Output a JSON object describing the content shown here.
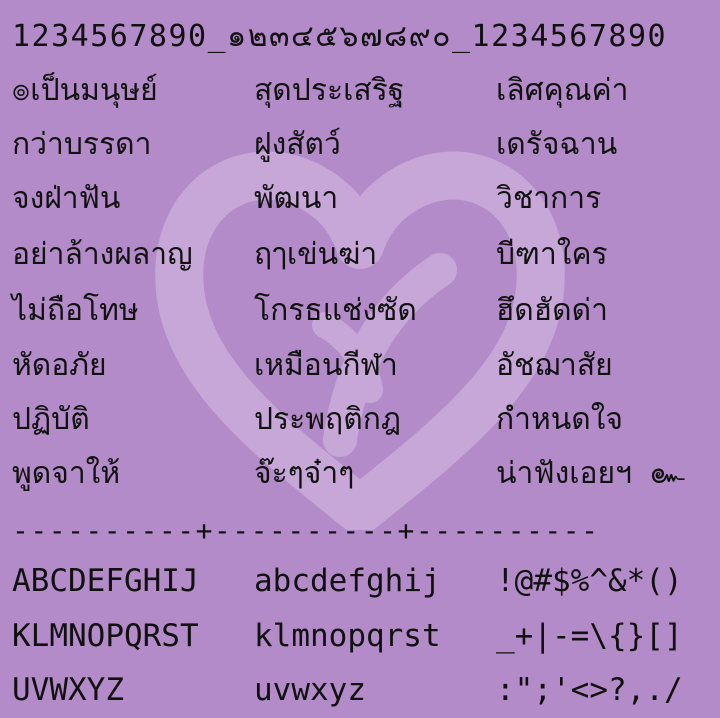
{
  "header_line": "1234567890_๑๒๓๔๕๖๗๘๙๐_1234567890",
  "thai_rows": [
    [
      "๏เป็นมนุษย์",
      "สุดประเสริฐ",
      "เลิศคุณค่า"
    ],
    [
      "กว่าบรรดา",
      "ฝูงสัตว์",
      "เดรัจฉาน"
    ],
    [
      "จงฝ่าฟัน",
      "พัฒนา",
      "วิชาการ"
    ],
    [
      "อย่าล้างผลาญ",
      "ฤๅเข่นฆ่า",
      "บีฑาใคร"
    ],
    [
      "ไม่ถือโทษ",
      "โกรธแช่งซัด",
      "ฮึดฮัดด่า"
    ],
    [
      "หัดอภัย",
      "เหมือนกีฬา",
      "อัชฌาสัย"
    ],
    [
      "ปฏิบัติ",
      "ประพฤติกฎ",
      "กำหนดใจ"
    ],
    [
      "พูดจาให้",
      "จ๊ะๆจ๋าๆ",
      "น่าฟังเอยฯ ๛"
    ]
  ],
  "divider": "----------+----------+----------",
  "latin_rows": [
    [
      "ABCDEFGHIJ",
      "abcdefghij",
      "!@#$%^&*()"
    ],
    [
      "KLMNOPQRST",
      "klmnopqrst",
      "_+|-=\\{}[]"
    ],
    [
      "UVWXYZ",
      "uvwxyz",
      ":\";'<>?,./"
    ]
  ],
  "watermark_icon": "heart-icon"
}
